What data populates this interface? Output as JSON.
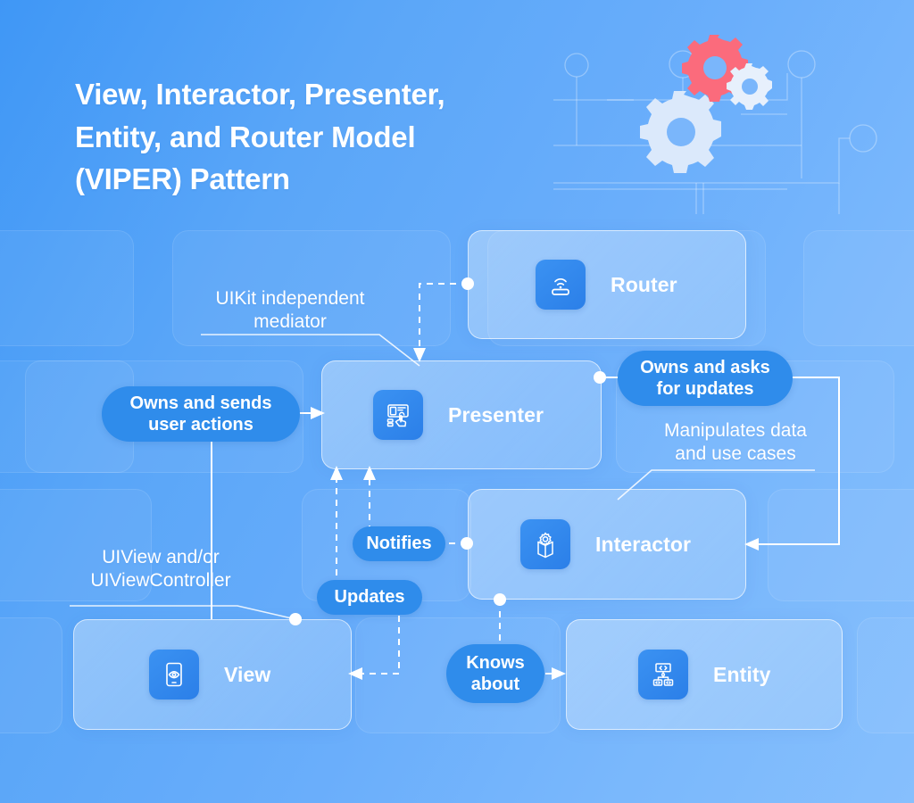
{
  "page": {
    "title_lines": "View, Interactor, Presenter,\nEntity, and Router Model\n(VIPER) Pattern",
    "background_color": "#63aafa",
    "accent_color": "#2f8ceb",
    "gear_accent_color": "#fb6b7c"
  },
  "nodes": [
    {
      "id": "router",
      "label": "Router",
      "icon": "wifi-router-icon"
    },
    {
      "id": "presenter",
      "label": "Presenter",
      "icon": "presenter-screen-hand-icon"
    },
    {
      "id": "interactor",
      "label": "Interactor",
      "icon": "box-gear-icon"
    },
    {
      "id": "view",
      "label": "View",
      "icon": "phone-eye-icon"
    },
    {
      "id": "entity",
      "label": "Entity",
      "icon": "code-hierarchy-icon"
    }
  ],
  "pills": [
    {
      "id": "owns-sends-user-actions",
      "text": "Owns and sends\nuser actions"
    },
    {
      "id": "owns-asks-for-updates",
      "text": "Owns and asks\nfor updates"
    },
    {
      "id": "notifies",
      "text": "Notifies"
    },
    {
      "id": "updates",
      "text": "Updates"
    },
    {
      "id": "knows-about",
      "text": "Knows\nabout"
    }
  ],
  "captions": [
    {
      "id": "uikit-independent-mediator",
      "text": "UIKit independent\nmediator"
    },
    {
      "id": "manipulates-data",
      "text": "Manipulates data\nand use cases"
    },
    {
      "id": "uiview-controller",
      "text": "UIView and/or\nUIViewController"
    }
  ],
  "decoration": {
    "gears": [
      "gear-large-icon",
      "gear-red-icon",
      "gear-small-icon"
    ]
  }
}
